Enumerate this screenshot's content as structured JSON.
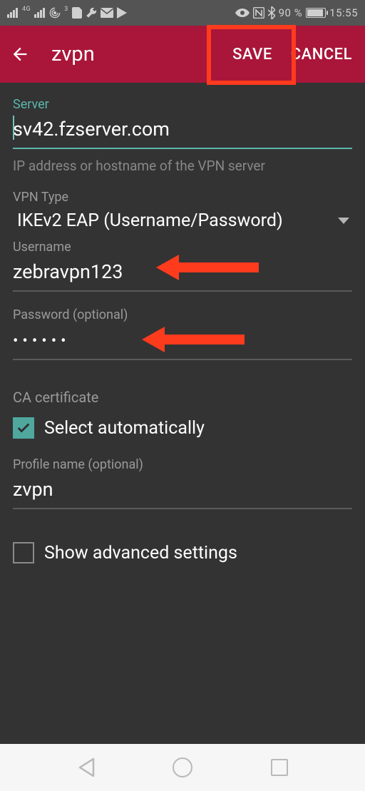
{
  "status": {
    "left_icons": [
      "signal-icon",
      "signal-4g-icon",
      "hotspot-icon",
      "alert-badge-icon",
      "wrench-icon",
      "mail-icon",
      "play-icon"
    ],
    "left_badge": "3",
    "lte": "4G",
    "right_icons": [
      "eye-icon",
      "nfc-icon",
      "bluetooth-icon"
    ],
    "battery_percent": "90 %",
    "time": "15:55"
  },
  "appbar": {
    "title": "zvpn",
    "save": "SAVE",
    "cancel": "CANCEL"
  },
  "fields": {
    "server_label": "Server",
    "server_value": "sv42.fzserver.com",
    "server_helper": "IP address or hostname of the VPN server",
    "vpntype_label": "VPN Type",
    "vpntype_value": "IKEv2 EAP (Username/Password)",
    "username_label": "Username",
    "username_value": "zebravpn123",
    "password_label": "Password (optional)",
    "password_masked": "••••••",
    "ca_label": "CA certificate",
    "ca_checkbox_label": "Select automatically",
    "ca_checked": true,
    "profile_label": "Profile name (optional)",
    "profile_value": "zvpn",
    "advanced_label": "Show advanced settings",
    "advanced_checked": false
  },
  "colors": {
    "accent": "#5bb6ad",
    "appbar": "#a9163a",
    "highlight": "#ff3b1e"
  },
  "annotations": {
    "save_highlight": true,
    "arrow_username": true,
    "arrow_password": true
  }
}
